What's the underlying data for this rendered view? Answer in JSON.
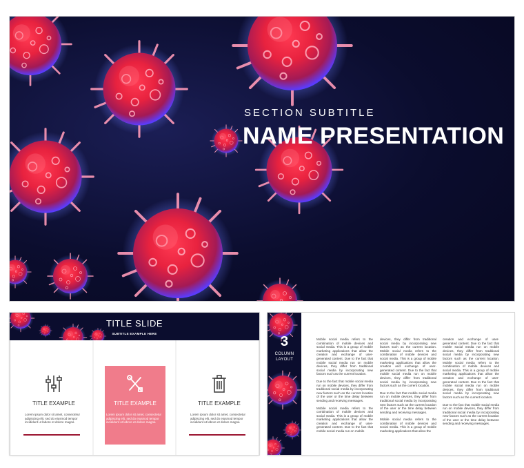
{
  "hero": {
    "section_subtitle": "SECTION SUBTITLE",
    "title": "NAME PRESENTATION"
  },
  "thumbnail_title_slide": {
    "title": "TITLE SLIDE",
    "subtitle": "SUBTITLE EXAMPLE HERE",
    "cards": [
      {
        "icon": "sliders-icon",
        "label": "TITLE EXAMPLE",
        "text": "Lorem ipsum dolor sit amet, consectetur adipiscing elit, sed do eiusmod tempor incididunt ut labore et dolore magna"
      },
      {
        "icon": "tools-icon",
        "label": "TITLE EXAMPLE",
        "text": "Lorem ipsum dolor sit amet, consectetur adipiscing elit, sed do eiusmod tempor incididunt ut labore et dolore magna"
      },
      {
        "icon": "trash-icon",
        "label": "TITLE EXAMPLE",
        "text": "Lorem ipsum dolor sit amet, consectetur adipiscing elit, sed do eiusmod tempor incididunt ut labore et dolore magna"
      }
    ]
  },
  "thumbnail_columns": {
    "number": "3",
    "label_line1": "COLUMN",
    "label_line2": "LAYOUT",
    "columns": [
      [
        "Mobile social media refers to the combination of mobile devices and social media. This is a group of mobile marketing applications that allow the creation and exchange of user-generated content. Due to the fact that mobile social media run on mobile devices, they differ from traditional social media by incorporating new factors such as the current location.",
        "Due to the fact that mobile social media run on mobile devices, they differ from traditional social media by incorporating new factors such as the current location of the user or the time delay between sending and receiving messages.",
        "Mobile social media refers to the combination of mobile devices and social media. This is a group of mobile marketing applications that allow the creation and exchange of user-generated content. Due to the fact that mobile social media run on mobile"
      ],
      [
        "devices, they differ from traditional social media by incorporating new factors such as the current location. Mobile social media refers to the combination of mobile devices and social media. This is a group of mobile marketing applications that allow the creation and exchange of user-generated content. Due to the fact that mobile social media run on mobile devices, they differ from traditional social media by incorporating new factors such as the current location.",
        "Due to the fact that mobile social media run on mobile devices, they differ from traditional social media by incorporating new factors such as the current location of the user or the time delay between sending and receiving messages.",
        "Mobile social media refers to the combination of mobile devices and social media. This is a group of mobile marketing applications that allow the"
      ],
      [
        "creation and exchange of user-generated content. Due to the fact that mobile social media run on mobile devices, they differ from traditional social media by incorporating new factors such as the current location. Mobile social media refers to the combination of mobile devices and social media. This is a group of mobile marketing applications that allow the creation and exchange of user-generated content. Due to the fact that mobile social media run on mobile devices, they differ from traditional social media by incorporating new factors such as the current location.",
        "Due to the fact that mobile social media run on mobile devices, they differ from traditional social media by incorporating new factors such as the current location of the user or the time delay between sending and receiving messages."
      ]
    ]
  },
  "colors": {
    "background_navy": "#0b0d2e",
    "virus_red": "#f0304a",
    "virus_glow_blue": "#4a6cff",
    "card_pink": "#f07c8b",
    "accent_line": "#9b1530"
  }
}
